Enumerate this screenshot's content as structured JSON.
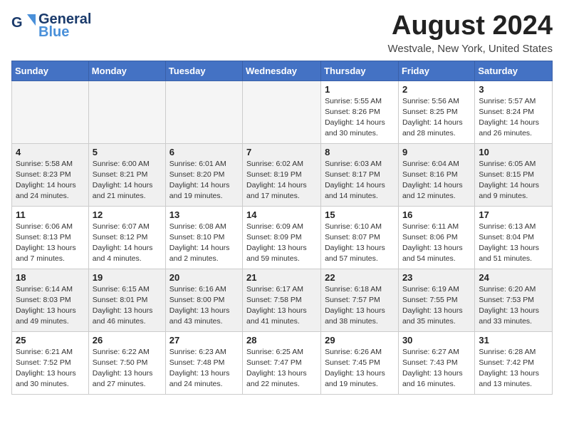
{
  "header": {
    "logo_general": "General",
    "logo_blue": "Blue",
    "month_title": "August 2024",
    "location": "Westvale, New York, United States"
  },
  "weekdays": [
    "Sunday",
    "Monday",
    "Tuesday",
    "Wednesday",
    "Thursday",
    "Friday",
    "Saturday"
  ],
  "weeks": [
    [
      {
        "day": "",
        "empty": true
      },
      {
        "day": "",
        "empty": true
      },
      {
        "day": "",
        "empty": true
      },
      {
        "day": "",
        "empty": true
      },
      {
        "day": "1",
        "sunrise": "5:55 AM",
        "sunset": "8:26 PM",
        "daylight": "14 hours and 30 minutes."
      },
      {
        "day": "2",
        "sunrise": "5:56 AM",
        "sunset": "8:25 PM",
        "daylight": "14 hours and 28 minutes."
      },
      {
        "day": "3",
        "sunrise": "5:57 AM",
        "sunset": "8:24 PM",
        "daylight": "14 hours and 26 minutes."
      }
    ],
    [
      {
        "day": "4",
        "sunrise": "5:58 AM",
        "sunset": "8:23 PM",
        "daylight": "14 hours and 24 minutes."
      },
      {
        "day": "5",
        "sunrise": "6:00 AM",
        "sunset": "8:21 PM",
        "daylight": "14 hours and 21 minutes."
      },
      {
        "day": "6",
        "sunrise": "6:01 AM",
        "sunset": "8:20 PM",
        "daylight": "14 hours and 19 minutes."
      },
      {
        "day": "7",
        "sunrise": "6:02 AM",
        "sunset": "8:19 PM",
        "daylight": "14 hours and 17 minutes."
      },
      {
        "day": "8",
        "sunrise": "6:03 AM",
        "sunset": "8:17 PM",
        "daylight": "14 hours and 14 minutes."
      },
      {
        "day": "9",
        "sunrise": "6:04 AM",
        "sunset": "8:16 PM",
        "daylight": "14 hours and 12 minutes."
      },
      {
        "day": "10",
        "sunrise": "6:05 AM",
        "sunset": "8:15 PM",
        "daylight": "14 hours and 9 minutes."
      }
    ],
    [
      {
        "day": "11",
        "sunrise": "6:06 AM",
        "sunset": "8:13 PM",
        "daylight": "13 hours and 7 minutes."
      },
      {
        "day": "12",
        "sunrise": "6:07 AM",
        "sunset": "8:12 PM",
        "daylight": "14 hours and 4 minutes."
      },
      {
        "day": "13",
        "sunrise": "6:08 AM",
        "sunset": "8:10 PM",
        "daylight": "14 hours and 2 minutes."
      },
      {
        "day": "14",
        "sunrise": "6:09 AM",
        "sunset": "8:09 PM",
        "daylight": "13 hours and 59 minutes."
      },
      {
        "day": "15",
        "sunrise": "6:10 AM",
        "sunset": "8:07 PM",
        "daylight": "13 hours and 57 minutes."
      },
      {
        "day": "16",
        "sunrise": "6:11 AM",
        "sunset": "8:06 PM",
        "daylight": "13 hours and 54 minutes."
      },
      {
        "day": "17",
        "sunrise": "6:13 AM",
        "sunset": "8:04 PM",
        "daylight": "13 hours and 51 minutes."
      }
    ],
    [
      {
        "day": "18",
        "sunrise": "6:14 AM",
        "sunset": "8:03 PM",
        "daylight": "13 hours and 49 minutes."
      },
      {
        "day": "19",
        "sunrise": "6:15 AM",
        "sunset": "8:01 PM",
        "daylight": "13 hours and 46 minutes."
      },
      {
        "day": "20",
        "sunrise": "6:16 AM",
        "sunset": "8:00 PM",
        "daylight": "13 hours and 43 minutes."
      },
      {
        "day": "21",
        "sunrise": "6:17 AM",
        "sunset": "7:58 PM",
        "daylight": "13 hours and 41 minutes."
      },
      {
        "day": "22",
        "sunrise": "6:18 AM",
        "sunset": "7:57 PM",
        "daylight": "13 hours and 38 minutes."
      },
      {
        "day": "23",
        "sunrise": "6:19 AM",
        "sunset": "7:55 PM",
        "daylight": "13 hours and 35 minutes."
      },
      {
        "day": "24",
        "sunrise": "6:20 AM",
        "sunset": "7:53 PM",
        "daylight": "13 hours and 33 minutes."
      }
    ],
    [
      {
        "day": "25",
        "sunrise": "6:21 AM",
        "sunset": "7:52 PM",
        "daylight": "13 hours and 30 minutes."
      },
      {
        "day": "26",
        "sunrise": "6:22 AM",
        "sunset": "7:50 PM",
        "daylight": "13 hours and 27 minutes."
      },
      {
        "day": "27",
        "sunrise": "6:23 AM",
        "sunset": "7:48 PM",
        "daylight": "13 hours and 24 minutes."
      },
      {
        "day": "28",
        "sunrise": "6:25 AM",
        "sunset": "7:47 PM",
        "daylight": "13 hours and 22 minutes."
      },
      {
        "day": "29",
        "sunrise": "6:26 AM",
        "sunset": "7:45 PM",
        "daylight": "13 hours and 19 minutes."
      },
      {
        "day": "30",
        "sunrise": "6:27 AM",
        "sunset": "7:43 PM",
        "daylight": "13 hours and 16 minutes."
      },
      {
        "day": "31",
        "sunrise": "6:28 AM",
        "sunset": "7:42 PM",
        "daylight": "13 hours and 13 minutes."
      }
    ]
  ],
  "labels": {
    "sunrise": "Sunrise:",
    "sunset": "Sunset:",
    "daylight": "Daylight:"
  }
}
